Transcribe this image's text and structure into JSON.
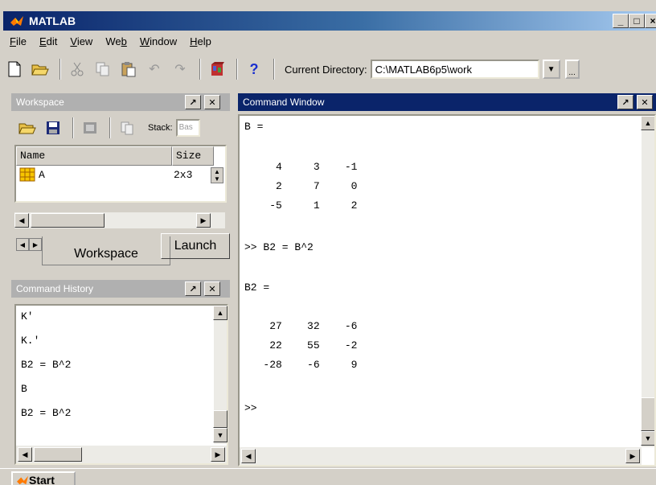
{
  "app": {
    "title": "MATLAB",
    "min_label": "_",
    "max_label": "□",
    "close_label": "×"
  },
  "menu": [
    {
      "label": "File",
      "ul": "F",
      "rest": "ile"
    },
    {
      "label": "Edit",
      "ul": "E",
      "rest": "dit"
    },
    {
      "label": "View",
      "ul": "V",
      "rest": "iew"
    },
    {
      "label": "Web",
      "pre": "We",
      "ul": "b"
    },
    {
      "label": "Window",
      "ul": "W",
      "rest": "indow"
    },
    {
      "label": "Help",
      "ul": "H",
      "rest": "elp"
    }
  ],
  "toolbar": {
    "current_directory_label": "Current Directory:",
    "current_directory_value": "C:\\MATLAB6p5\\work",
    "help_label": "?",
    "browse_label": "..."
  },
  "workspace": {
    "header": "Workspace",
    "stack_label": "Stack:",
    "stack_value": "Bas",
    "columns": [
      "Name",
      "Size"
    ],
    "rows": [
      {
        "name": "A",
        "size": "2x3"
      }
    ],
    "tabs": {
      "workspace": "Workspace",
      "launch": "Launch"
    }
  },
  "history": {
    "header": "Command History",
    "lines": [
      "K'",
      "K.'",
      "B2 = B^2",
      "B",
      "B2 = B^2"
    ]
  },
  "command_window": {
    "header": "Command Window",
    "lines": [
      "B =",
      "",
      "     4     3    -1",
      "     2     7     0",
      "    -5     1     2",
      "",
      ">> B2 = B^2",
      "",
      "B2 =",
      "",
      "    27    32    -6",
      "    22    55    -2",
      "   -28    -6     9",
      "",
      ">>"
    ]
  },
  "taskbar": {
    "start_label": "Start"
  },
  "colors": {
    "title_active": "#0a246a",
    "panel_inactive": "#b0b0b0",
    "face": "#d4d0c8"
  }
}
